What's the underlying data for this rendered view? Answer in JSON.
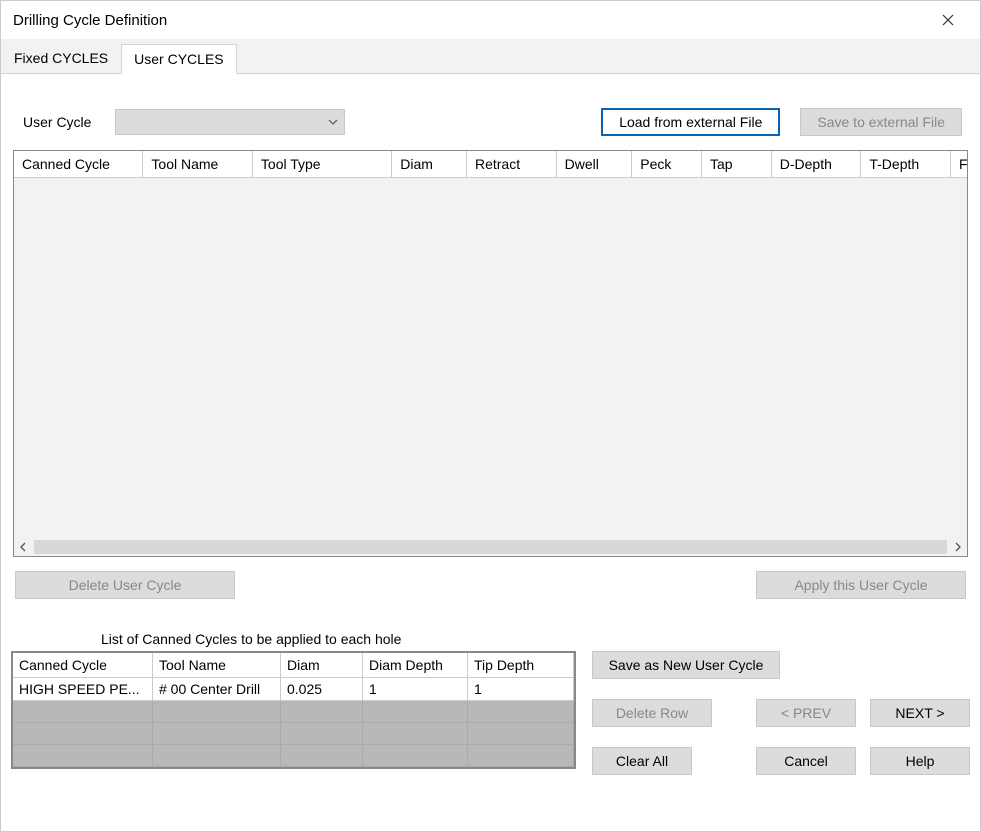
{
  "window": {
    "title": "Drilling Cycle Definition"
  },
  "tabs": {
    "fixed": "Fixed CYCLES",
    "user": "User CYCLES"
  },
  "labels": {
    "user_cycle": "User Cycle",
    "lcc_header": "List of Canned Cycles to be applied to each hole"
  },
  "buttons": {
    "load_ext": "Load from external File",
    "save_ext": "Save to external File",
    "delete_uc": "Delete User Cycle",
    "apply_uc": "Apply this User Cycle",
    "save_new_uc": "Save as New User Cycle",
    "delete_row": "Delete Row",
    "prev": "<  PREV",
    "next": "NEXT  >",
    "clear_all": "Clear All",
    "cancel": "Cancel",
    "help": "Help"
  },
  "grid_upper": {
    "cols": [
      "Canned Cycle",
      "Tool Name",
      "Tool Type",
      "Diam",
      "Retract",
      "Dwell",
      "Peck",
      "Tap",
      "D-Depth",
      "T-Depth",
      "Feed"
    ]
  },
  "grid_lower": {
    "cols": [
      "Canned Cycle",
      "Tool Name",
      "Diam",
      "Diam Depth",
      "Tip Depth"
    ],
    "rows": [
      {
        "cc": "HIGH SPEED PE...",
        "tn": "# 00 Center Drill",
        "d": "0.025",
        "dd": "1",
        "td": "1"
      }
    ]
  }
}
